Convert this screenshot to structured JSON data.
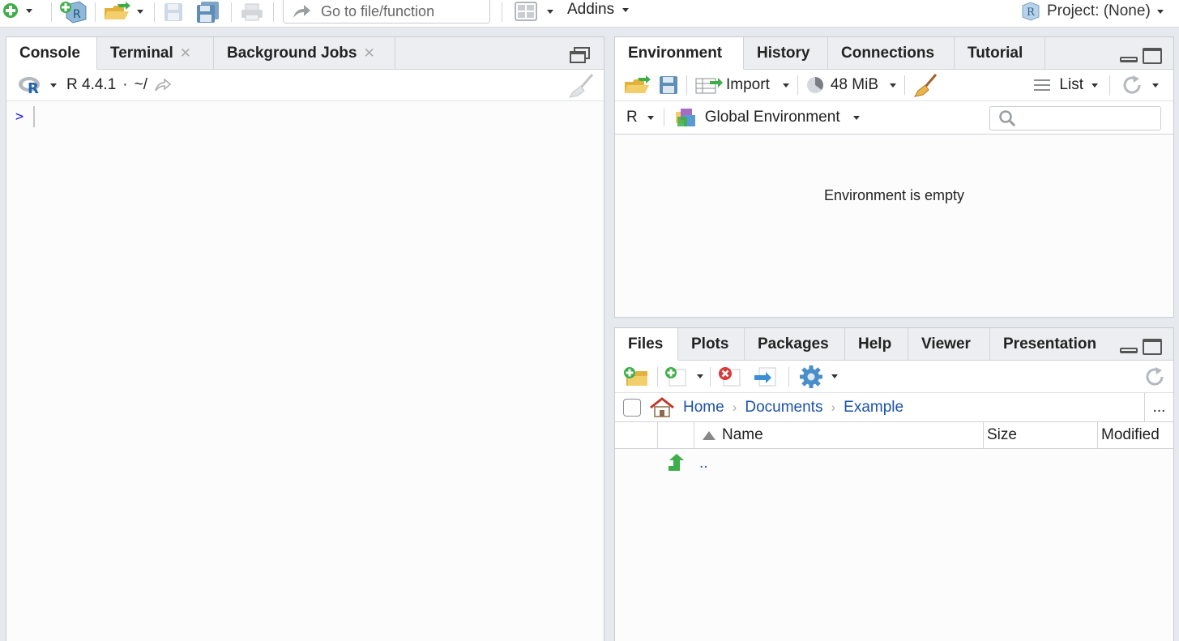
{
  "toolbar": {
    "goto_placeholder": "Go to file/function",
    "addins_label": "Addins",
    "project_label": "Project: (None)"
  },
  "console_pane": {
    "tabs": [
      {
        "label": "Console",
        "closable": false
      },
      {
        "label": "Terminal",
        "closable": true
      },
      {
        "label": "Background Jobs",
        "closable": true
      }
    ],
    "r_version": "R 4.4.1",
    "separator": "·",
    "working_dir": "~/",
    "prompt": ">"
  },
  "env_pane": {
    "tabs": [
      "Environment",
      "History",
      "Connections",
      "Tutorial"
    ],
    "import_label": "Import",
    "memory_label": "48 MiB",
    "view_label": "List",
    "language_label": "R",
    "scope_label": "Global Environment",
    "empty_message": "Environment is empty"
  },
  "files_pane": {
    "tabs": [
      "Files",
      "Plots",
      "Packages",
      "Help",
      "Viewer",
      "Presentation"
    ],
    "breadcrumb": [
      "Home",
      "Documents",
      "Example"
    ],
    "more_label": "...",
    "columns": {
      "name": "Name",
      "size": "Size",
      "modified": "Modified"
    },
    "rows": [
      {
        "name": ".."
      }
    ]
  },
  "colors": {
    "accent_green": "#3fae49",
    "link_blue": "#1c52a8",
    "prompt_blue": "#1a1aff",
    "delete_red": "#d63a3a"
  }
}
